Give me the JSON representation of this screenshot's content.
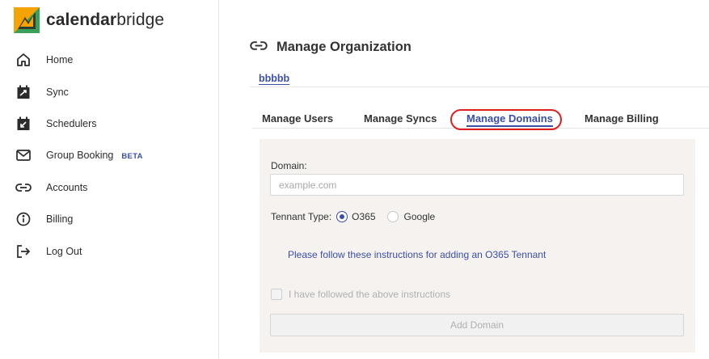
{
  "logo": {
    "part1": "calendar",
    "part2": "bridge",
    "colors": {
      "orange": "#f5a300",
      "green": "#3aa05a",
      "dark": "#2b2b2b"
    }
  },
  "sidebar": {
    "items": [
      {
        "label": "Home",
        "icon": "home-icon"
      },
      {
        "label": "Sync",
        "icon": "sync-calendar-icon"
      },
      {
        "label": "Schedulers",
        "icon": "scheduler-calendar-icon"
      },
      {
        "label": "Group Booking",
        "icon": "envelope-icon",
        "badge": "BETA"
      },
      {
        "label": "Accounts",
        "icon": "link-icon"
      },
      {
        "label": "Billing",
        "icon": "info-icon"
      },
      {
        "label": "Log Out",
        "icon": "logout-icon"
      }
    ]
  },
  "page": {
    "title": "Manage Organization",
    "title_icon": "link-icon",
    "org_name": "bbbbb"
  },
  "tabs": [
    {
      "label": "Manage Users"
    },
    {
      "label": "Manage Syncs"
    },
    {
      "label": "Manage Domains",
      "active": true
    },
    {
      "label": "Manage Billing"
    }
  ],
  "form": {
    "domain_label": "Domain:",
    "domain_placeholder": "example.com",
    "domain_value": "",
    "tennant_label": "Tennant Type:",
    "tennant_options": [
      "O365",
      "Google"
    ],
    "tennant_selected": "O365",
    "instructions_link": "Please follow these instructions for adding an O365 Tennant",
    "confirm_label": "I have followed the above instructions",
    "confirm_checked": false,
    "submit_label": "Add Domain"
  },
  "colors": {
    "accent": "#3b4fa8",
    "highlight_ring": "#e02020",
    "panel_bg": "#f5f2ef"
  }
}
